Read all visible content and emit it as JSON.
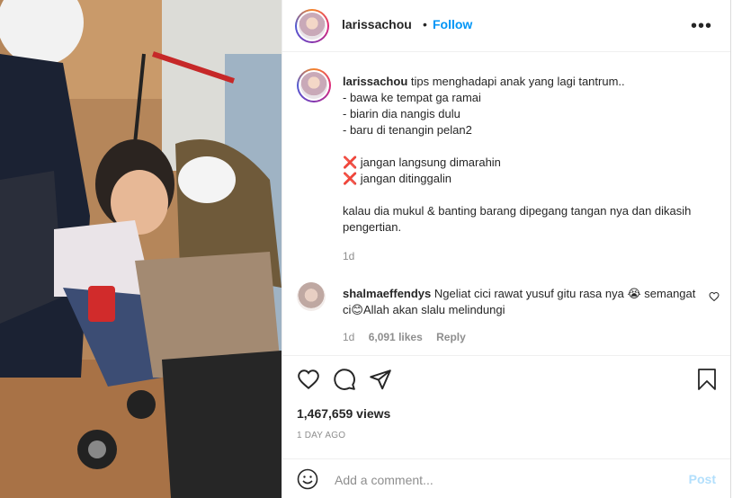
{
  "post": {
    "username": "larissachou",
    "separator": "•",
    "follow_label": "Follow",
    "more_label": "•••"
  },
  "caption": {
    "username": "larissachou",
    "text": " tips menghadapi anak yang lagi tantrum..\n- bawa ke tempat ga ramai\n- biarin dia nangis dulu\n- baru di tenangin pelan2\n\n❌ jangan langsung dimarahin\n❌ jangan ditinggalin\n\nkalau dia mukul & banting barang dipegang tangan nya dan dikasih pengertian.",
    "time": "1d"
  },
  "comment": {
    "username": "shalmaeffendys",
    "text": " Ngeliat cici rawat yusuf gitu rasa nya 😭 semangat ci😊Allah akan slalu melindungi",
    "time": "1d",
    "likes": "6,091 likes",
    "reply_label": "Reply"
  },
  "stats": {
    "views": "1,467,659 views",
    "date": "1 DAY AGO"
  },
  "composer": {
    "placeholder": "Add a comment...",
    "post_label": "Post"
  },
  "icons": {
    "like": "heart-icon",
    "comment": "comment-bubble-icon",
    "share": "paper-plane-icon",
    "save": "bookmark-icon",
    "emoji": "smiley-icon"
  },
  "colors": {
    "accent": "#0095f6",
    "muted": "#8e8e8e",
    "post_disabled": "#b2dffc"
  }
}
